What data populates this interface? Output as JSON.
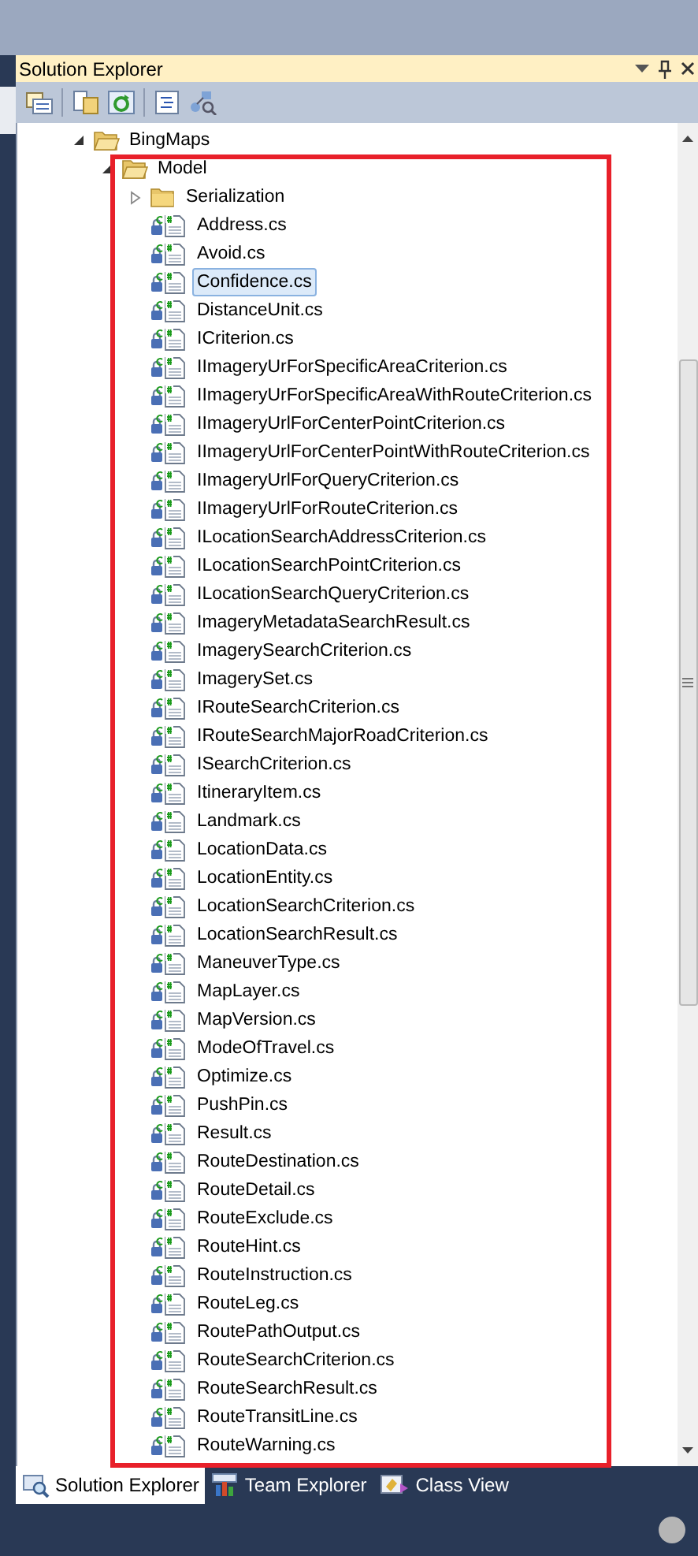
{
  "window": {
    "title": "Solution Explorer"
  },
  "tree": [
    {
      "label": "BingMaps",
      "kind": "folder",
      "expanded": true,
      "selected": false,
      "children": [
        {
          "label": "Model",
          "kind": "folder",
          "expanded": true,
          "selected": false,
          "children": [
            {
              "label": "Serialization",
              "kind": "folder",
              "expanded": false,
              "selected": false
            },
            {
              "label": "Address.cs",
              "kind": "file",
              "selected": false
            },
            {
              "label": "Avoid.cs",
              "kind": "file",
              "selected": false
            },
            {
              "label": "Confidence.cs",
              "kind": "file",
              "selected": true
            },
            {
              "label": "DistanceUnit.cs",
              "kind": "file",
              "selected": false
            },
            {
              "label": "ICriterion.cs",
              "kind": "file",
              "selected": false
            },
            {
              "label": "IImageryUrForSpecificAreaCriterion.cs",
              "kind": "file",
              "selected": false
            },
            {
              "label": "IImageryUrForSpecificAreaWithRouteCriterion.cs",
              "kind": "file",
              "selected": false
            },
            {
              "label": "IImageryUrlForCenterPointCriterion.cs",
              "kind": "file",
              "selected": false
            },
            {
              "label": "IImageryUrlForCenterPointWithRouteCriterion.cs",
              "kind": "file",
              "selected": false
            },
            {
              "label": "IImageryUrlForQueryCriterion.cs",
              "kind": "file",
              "selected": false
            },
            {
              "label": "IImageryUrlForRouteCriterion.cs",
              "kind": "file",
              "selected": false
            },
            {
              "label": "ILocationSearchAddressCriterion.cs",
              "kind": "file",
              "selected": false
            },
            {
              "label": "ILocationSearchPointCriterion.cs",
              "kind": "file",
              "selected": false
            },
            {
              "label": "ILocationSearchQueryCriterion.cs",
              "kind": "file",
              "selected": false
            },
            {
              "label": "ImageryMetadataSearchResult.cs",
              "kind": "file",
              "selected": false
            },
            {
              "label": "ImagerySearchCriterion.cs",
              "kind": "file",
              "selected": false
            },
            {
              "label": "ImagerySet.cs",
              "kind": "file",
              "selected": false
            },
            {
              "label": "IRouteSearchCriterion.cs",
              "kind": "file",
              "selected": false
            },
            {
              "label": "IRouteSearchMajorRoadCriterion.cs",
              "kind": "file",
              "selected": false
            },
            {
              "label": "ISearchCriterion.cs",
              "kind": "file",
              "selected": false
            },
            {
              "label": "ItineraryItem.cs",
              "kind": "file",
              "selected": false
            },
            {
              "label": "Landmark.cs",
              "kind": "file",
              "selected": false
            },
            {
              "label": "LocationData.cs",
              "kind": "file",
              "selected": false
            },
            {
              "label": "LocationEntity.cs",
              "kind": "file",
              "selected": false
            },
            {
              "label": "LocationSearchCriterion.cs",
              "kind": "file",
              "selected": false
            },
            {
              "label": "LocationSearchResult.cs",
              "kind": "file",
              "selected": false
            },
            {
              "label": "ManeuverType.cs",
              "kind": "file",
              "selected": false
            },
            {
              "label": "MapLayer.cs",
              "kind": "file",
              "selected": false
            },
            {
              "label": "MapVersion.cs",
              "kind": "file",
              "selected": false
            },
            {
              "label": "ModeOfTravel.cs",
              "kind": "file",
              "selected": false
            },
            {
              "label": "Optimize.cs",
              "kind": "file",
              "selected": false
            },
            {
              "label": "PushPin.cs",
              "kind": "file",
              "selected": false
            },
            {
              "label": "Result.cs",
              "kind": "file",
              "selected": false
            },
            {
              "label": "RouteDestination.cs",
              "kind": "file",
              "selected": false
            },
            {
              "label": "RouteDetail.cs",
              "kind": "file",
              "selected": false
            },
            {
              "label": "RouteExclude.cs",
              "kind": "file",
              "selected": false
            },
            {
              "label": "RouteHint.cs",
              "kind": "file",
              "selected": false
            },
            {
              "label": "RouteInstruction.cs",
              "kind": "file",
              "selected": false
            },
            {
              "label": "RouteLeg.cs",
              "kind": "file",
              "selected": false
            },
            {
              "label": "RoutePathOutput.cs",
              "kind": "file",
              "selected": false
            },
            {
              "label": "RouteSearchCriterion.cs",
              "kind": "file",
              "selected": false
            },
            {
              "label": "RouteSearchResult.cs",
              "kind": "file",
              "selected": false
            },
            {
              "label": "RouteTransitLine.cs",
              "kind": "file",
              "selected": false
            },
            {
              "label": "RouteWarning.cs",
              "kind": "file",
              "selected": false
            }
          ]
        }
      ]
    }
  ],
  "tabs": [
    {
      "label": "Solution Explorer",
      "kind": "solution",
      "selected": true
    },
    {
      "label": "Team Explorer",
      "kind": "team",
      "selected": false
    },
    {
      "label": "Class View",
      "kind": "class",
      "selected": false
    }
  ]
}
